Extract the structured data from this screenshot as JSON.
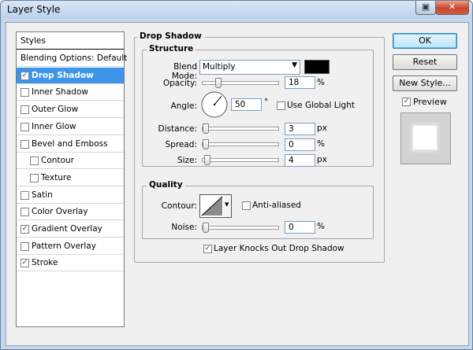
{
  "window": {
    "title": "Layer Style"
  },
  "styles_panel": {
    "header": "Styles",
    "items": [
      {
        "label": "Blending Options: Default",
        "checkbox": false,
        "checked": false,
        "indent": 0,
        "selected": false
      },
      {
        "label": "Drop Shadow",
        "checkbox": true,
        "checked": true,
        "indent": 0,
        "selected": true
      },
      {
        "label": "Inner Shadow",
        "checkbox": true,
        "checked": false,
        "indent": 0,
        "selected": false
      },
      {
        "label": "Outer Glow",
        "checkbox": true,
        "checked": false,
        "indent": 0,
        "selected": false
      },
      {
        "label": "Inner Glow",
        "checkbox": true,
        "checked": false,
        "indent": 0,
        "selected": false
      },
      {
        "label": "Bevel and Emboss",
        "checkbox": true,
        "checked": false,
        "indent": 0,
        "selected": false
      },
      {
        "label": "Contour",
        "checkbox": true,
        "checked": false,
        "indent": 1,
        "selected": false
      },
      {
        "label": "Texture",
        "checkbox": true,
        "checked": false,
        "indent": 1,
        "selected": false
      },
      {
        "label": "Satin",
        "checkbox": true,
        "checked": false,
        "indent": 0,
        "selected": false
      },
      {
        "label": "Color Overlay",
        "checkbox": true,
        "checked": false,
        "indent": 0,
        "selected": false
      },
      {
        "label": "Gradient Overlay",
        "checkbox": true,
        "checked": true,
        "indent": 0,
        "selected": false
      },
      {
        "label": "Pattern Overlay",
        "checkbox": true,
        "checked": false,
        "indent": 0,
        "selected": false
      },
      {
        "label": "Stroke",
        "checkbox": true,
        "checked": true,
        "indent": 0,
        "selected": false
      }
    ]
  },
  "drop_shadow": {
    "title": "Drop Shadow",
    "structure": {
      "title": "Structure",
      "blend_mode_label": "Blend Mode:",
      "blend_mode_value": "Multiply",
      "shadow_color": "#000000",
      "opacity_label": "Opacity:",
      "opacity_value": "18",
      "opacity_unit": "%",
      "opacity_fraction": 0.18,
      "angle_label": "Angle:",
      "angle_value": "50",
      "angle_unit": "°",
      "angle_degrees": 50,
      "use_global_light_label": "Use Global Light",
      "use_global_light_checked": false,
      "distance_label": "Distance:",
      "distance_value": "3",
      "distance_unit": "px",
      "distance_fraction": 0.0,
      "spread_label": "Spread:",
      "spread_value": "0",
      "spread_unit": "%",
      "spread_fraction": 0.0,
      "size_label": "Size:",
      "size_value": "4",
      "size_unit": "px",
      "size_fraction": 0.02
    },
    "quality": {
      "title": "Quality",
      "contour_label": "Contour:",
      "anti_aliased_label": "Anti-aliased",
      "anti_aliased_checked": false,
      "noise_label": "Noise:",
      "noise_value": "0",
      "noise_unit": "%",
      "noise_fraction": 0.0
    },
    "knockout_label": "Layer Knocks Out Drop Shadow",
    "knockout_checked": true
  },
  "buttons": {
    "ok": "OK",
    "reset": "Reset",
    "new_style": "New Style..."
  },
  "preview": {
    "label": "Preview",
    "checked": true
  },
  "colors": {
    "selection": "#3d95ea",
    "window_frame": "#c3d8ee",
    "dialog_bg": "#f0f0f0"
  }
}
